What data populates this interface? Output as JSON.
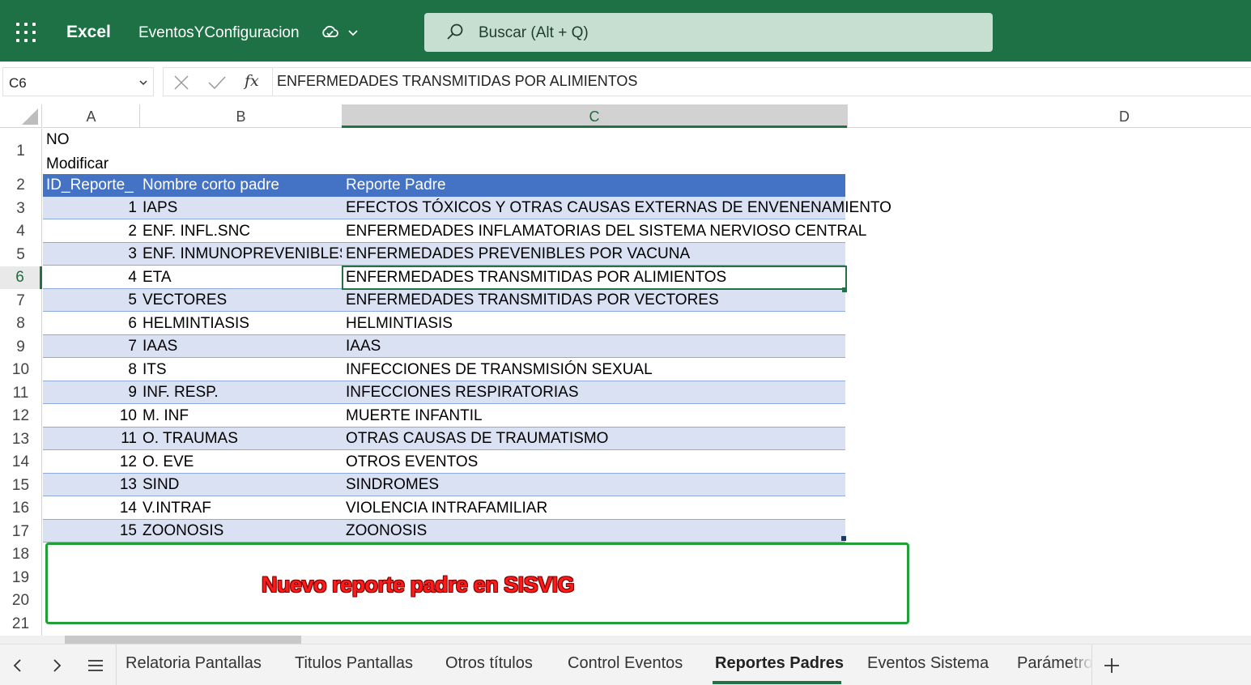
{
  "titlebar": {
    "app_name": "Excel",
    "doc_name": "EventosYConfiguracion",
    "search_placeholder": "Buscar (Alt + Q)",
    "bg_color": "#1e7145"
  },
  "formula_bar": {
    "name_box": "C6",
    "fx_label": "fx",
    "formula": "ENFERMEDADES TRANSMITIDAS POR ALIMIENTOS"
  },
  "columns": [
    "A",
    "B",
    "C",
    "D"
  ],
  "rows": {
    "r1": "1",
    "r2": "2",
    "r3": "3",
    "r4": "4",
    "r5": "5",
    "r6": "6",
    "r7": "7",
    "r8": "8",
    "r9": "9",
    "r10": "10",
    "r11": "11",
    "r12": "12",
    "r13": "13",
    "r14": "14",
    "r15": "15",
    "r16": "16",
    "r17": "17",
    "r18": "18",
    "r19": "19",
    "r20": "20",
    "r21": "21"
  },
  "cells": {
    "a1_line1": "NO",
    "a1_line2": "Modificar"
  },
  "table": {
    "headers": [
      "ID_Reporte_",
      "Nombre corto padre",
      "Reporte Padre"
    ],
    "rows": [
      {
        "id": "1",
        "short": "IAPS",
        "name": "EFECTOS TÓXICOS Y OTRAS CAUSAS EXTERNAS DE ENVENENAMIENTO"
      },
      {
        "id": "2",
        "short": "ENF. INFL.SNC",
        "name": "ENFERMEDADES INFLAMATORIAS DEL SISTEMA NERVIOSO CENTRAL"
      },
      {
        "id": "3",
        "short": " ENF. INMUNOPREVENIBLES",
        "name": "ENFERMEDADES PREVENIBLES POR VACUNA"
      },
      {
        "id": "4",
        "short": "ETA",
        "name": "ENFERMEDADES TRANSMITIDAS POR ALIMIENTOS"
      },
      {
        "id": "5",
        "short": "VECTORES",
        "name": "ENFERMEDADES TRANSMITIDAS POR VECTORES"
      },
      {
        "id": "6",
        "short": "HELMINTIASIS",
        "name": "HELMINTIASIS"
      },
      {
        "id": "7",
        "short": "IAAS",
        "name": "IAAS"
      },
      {
        "id": "8",
        "short": "ITS",
        "name": "INFECCIONES DE TRANSMISIÓN SEXUAL"
      },
      {
        "id": "9",
        "short": "INF. RESP.",
        "name": "INFECCIONES RESPIRATORIAS"
      },
      {
        "id": "10",
        "short": "M. INF",
        "name": "MUERTE INFANTIL"
      },
      {
        "id": "11",
        "short": "O. TRAUMAS",
        "name": "OTRAS CAUSAS DE TRAUMATISMO"
      },
      {
        "id": "12",
        "short": "O. EVE",
        "name": "OTROS EVENTOS"
      },
      {
        "id": "13",
        "short": "SIND",
        "name": "SINDROMES"
      },
      {
        "id": "14",
        "short": "V.INTRAF",
        "name": "VIOLENCIA INTRAFAMILIAR"
      },
      {
        "id": "15",
        "short": "ZOONOSIS",
        "name": "ZOONOSIS"
      }
    ],
    "header_color": "#4472c4",
    "band_color": "#d9e1f2"
  },
  "callout": {
    "text": "Nuevo reporte padre en SISVIG",
    "border_color": "#21a038",
    "text_color": "#ff1a1a"
  },
  "sheet_tabs": {
    "t1": "Relatoria Pantallas",
    "t2": "Titulos Pantallas",
    "t3": "Otros títulos",
    "t4": "Control Eventos",
    "t5": "Reportes Padres",
    "t6": "Eventos Sistema",
    "t7": "Parámetro",
    "active": "Reportes Padres"
  },
  "icons": [
    "waffle-icon",
    "sync-status-icon",
    "chevron-down-icon",
    "search-icon",
    "cancel-icon",
    "enter-icon",
    "fx-icon",
    "prev-sheet-icon",
    "next-sheet-icon",
    "all-sheets-icon",
    "add-sheet-icon"
  ]
}
